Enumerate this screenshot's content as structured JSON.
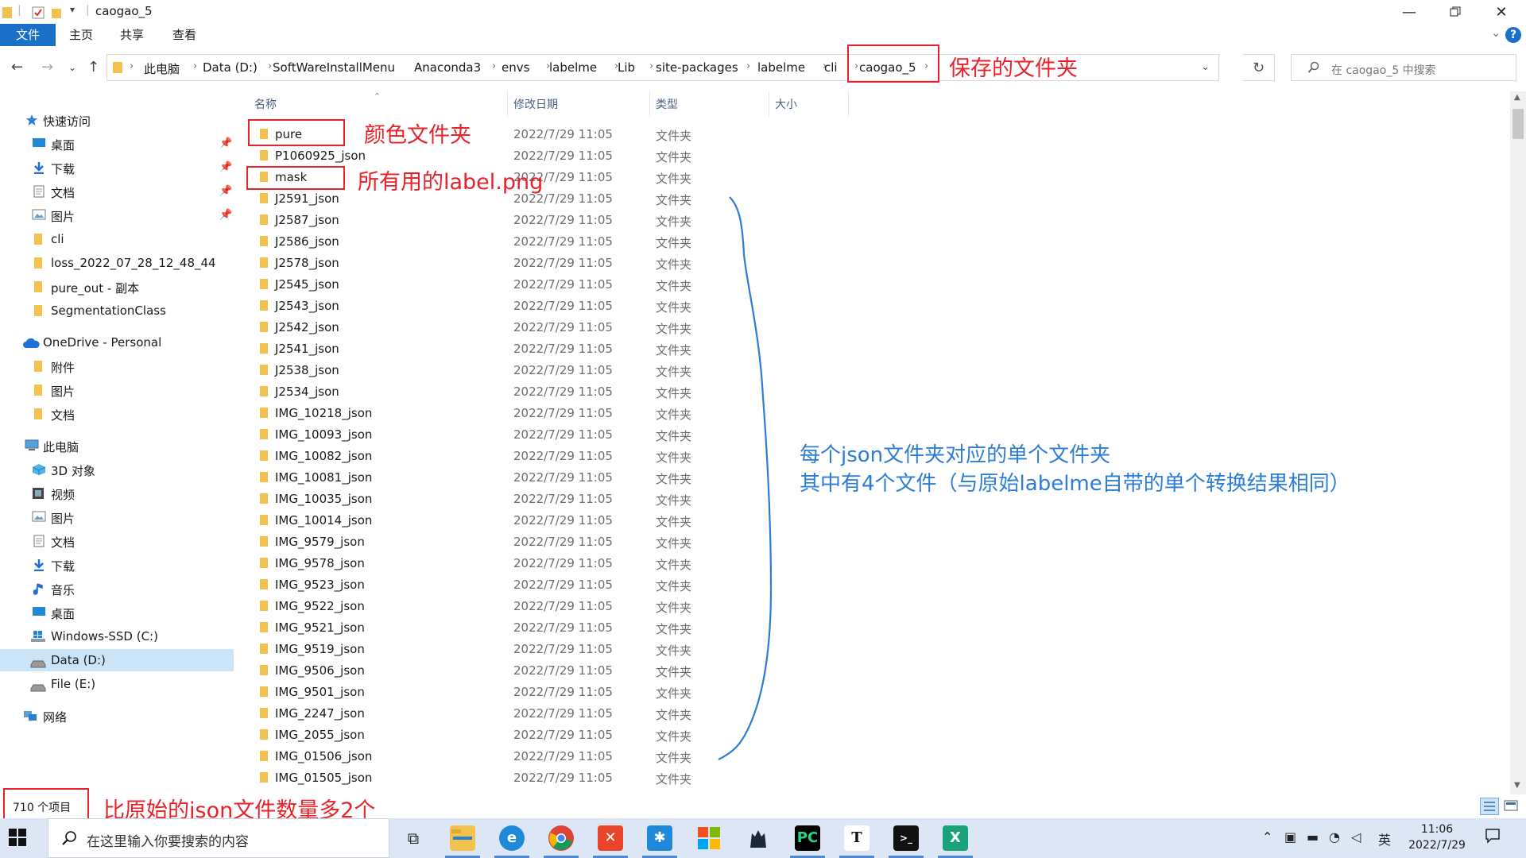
{
  "window": {
    "title": "caogao_5"
  },
  "ribbon": {
    "tabs": [
      "文件",
      "主页",
      "共享",
      "查看"
    ],
    "help": "?"
  },
  "breadcrumb": [
    "此电脑",
    "Data (D:)",
    "SoftWareInstallMenu",
    "Anaconda3",
    "envs",
    "labelme",
    "Lib",
    "site-packages",
    "labelme",
    "cli",
    "caogao_5"
  ],
  "search": {
    "placeholder": "在 caogao_5 中搜索"
  },
  "sidebar": {
    "quick_access": "快速访问",
    "quick_items": [
      "桌面",
      "下载",
      "文档",
      "图片",
      "cli",
      "loss_2022_07_28_12_48_44",
      "pure_out - 副本",
      "SegmentationClass"
    ],
    "onedrive": "OneDrive - Personal",
    "onedrive_items": [
      "附件",
      "图片",
      "文档"
    ],
    "this_pc": "此电脑",
    "pc_items": [
      "3D 对象",
      "视频",
      "图片",
      "文档",
      "下载",
      "音乐",
      "桌面",
      "Windows-SSD (C:)",
      "Data (D:)",
      "File (E:)"
    ],
    "network": "网络"
  },
  "columns": {
    "name": "名称",
    "date": "修改日期",
    "type": "类型",
    "size": "大小"
  },
  "files": [
    {
      "name": "pure",
      "date": "2022/7/29 11:05",
      "type": "文件夹"
    },
    {
      "name": "P1060925_json",
      "date": "2022/7/29 11:05",
      "type": "文件夹"
    },
    {
      "name": "mask",
      "date": "2022/7/29 11:05",
      "type": "文件夹"
    },
    {
      "name": "J2591_json",
      "date": "2022/7/29 11:05",
      "type": "文件夹"
    },
    {
      "name": "J2587_json",
      "date": "2022/7/29 11:05",
      "type": "文件夹"
    },
    {
      "name": "J2586_json",
      "date": "2022/7/29 11:05",
      "type": "文件夹"
    },
    {
      "name": "J2578_json",
      "date": "2022/7/29 11:05",
      "type": "文件夹"
    },
    {
      "name": "J2545_json",
      "date": "2022/7/29 11:05",
      "type": "文件夹"
    },
    {
      "name": "J2543_json",
      "date": "2022/7/29 11:05",
      "type": "文件夹"
    },
    {
      "name": "J2542_json",
      "date": "2022/7/29 11:05",
      "type": "文件夹"
    },
    {
      "name": "J2541_json",
      "date": "2022/7/29 11:05",
      "type": "文件夹"
    },
    {
      "name": "J2538_json",
      "date": "2022/7/29 11:05",
      "type": "文件夹"
    },
    {
      "name": "J2534_json",
      "date": "2022/7/29 11:05",
      "type": "文件夹"
    },
    {
      "name": "IMG_10218_json",
      "date": "2022/7/29 11:05",
      "type": "文件夹"
    },
    {
      "name": "IMG_10093_json",
      "date": "2022/7/29 11:05",
      "type": "文件夹"
    },
    {
      "name": "IMG_10082_json",
      "date": "2022/7/29 11:05",
      "type": "文件夹"
    },
    {
      "name": "IMG_10081_json",
      "date": "2022/7/29 11:05",
      "type": "文件夹"
    },
    {
      "name": "IMG_10035_json",
      "date": "2022/7/29 11:05",
      "type": "文件夹"
    },
    {
      "name": "IMG_10014_json",
      "date": "2022/7/29 11:05",
      "type": "文件夹"
    },
    {
      "name": "IMG_9579_json",
      "date": "2022/7/29 11:05",
      "type": "文件夹"
    },
    {
      "name": "IMG_9578_json",
      "date": "2022/7/29 11:05",
      "type": "文件夹"
    },
    {
      "name": "IMG_9523_json",
      "date": "2022/7/29 11:05",
      "type": "文件夹"
    },
    {
      "name": "IMG_9522_json",
      "date": "2022/7/29 11:05",
      "type": "文件夹"
    },
    {
      "name": "IMG_9521_json",
      "date": "2022/7/29 11:05",
      "type": "文件夹"
    },
    {
      "name": "IMG_9519_json",
      "date": "2022/7/29 11:05",
      "type": "文件夹"
    },
    {
      "name": "IMG_9506_json",
      "date": "2022/7/29 11:05",
      "type": "文件夹"
    },
    {
      "name": "IMG_9501_json",
      "date": "2022/7/29 11:05",
      "type": "文件夹"
    },
    {
      "name": "IMG_2247_json",
      "date": "2022/7/29 11:05",
      "type": "文件夹"
    },
    {
      "name": "IMG_2055_json",
      "date": "2022/7/29 11:05",
      "type": "文件夹"
    },
    {
      "name": "IMG_01506_json",
      "date": "2022/7/29 11:05",
      "type": "文件夹"
    },
    {
      "name": "IMG_01505_json",
      "date": "2022/7/29 11:05",
      "type": "文件夹"
    }
  ],
  "status": {
    "item_count": "710 个项目"
  },
  "annotations": {
    "save_folder": "保存的文件夹",
    "color_folder": "颜色文件夹",
    "mask_note": "所有用的label.png",
    "json_note_line1": "每个json文件夹对应的单个文件夹",
    "json_note_line2": "其中有4个文件（与原始labelme自带的单个转换结果相同）",
    "count_note": "比原始的json文件数量多2个"
  },
  "taskbar": {
    "search_placeholder": "在这里输入你要搜索的内容",
    "ime": "英",
    "time": "11:06",
    "date": "2022/7/29"
  },
  "colors": {
    "accent": "#1a6fc9",
    "annotation_red": "#e8222a",
    "annotation_blue": "#2b7dd6",
    "folder": "#f2c14e"
  }
}
